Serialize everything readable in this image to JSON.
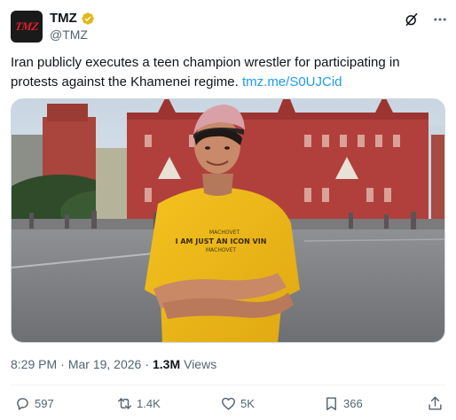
{
  "author": {
    "avatar_text": "TMZ",
    "display_name": "TMZ",
    "handle": "@TMZ",
    "verified_color": "#e2b719"
  },
  "tweet": {
    "text": "Iran publicly executes a teen champion wrestler for participating in protests against the Khamenei regime. ",
    "link": "tmz.me/S0UJCid"
  },
  "media": {
    "shirt_text_small": "MACHOVET",
    "shirt_text_main": "I AM JUST AN ICON VIN",
    "shirt_text_sub": "MACHOVET"
  },
  "meta": {
    "time": "8:29 PM",
    "separator": "·",
    "date": "Mar 19, 2026",
    "separator2": "·",
    "views_count": "1.3M",
    "views_label": "Views"
  },
  "actions": {
    "replies": "597",
    "reposts": "1.4K",
    "likes": "5K",
    "bookmarks": "366"
  },
  "icons": {
    "grok": "grok-icon",
    "more": "more-icon",
    "reply": "reply-icon",
    "repost": "repost-icon",
    "like": "heart-icon",
    "bookmark": "bookmark-icon",
    "share": "share-icon"
  },
  "colors": {
    "link": "#1d9bf0",
    "secondary": "#536471",
    "primary": "#0f1419"
  }
}
